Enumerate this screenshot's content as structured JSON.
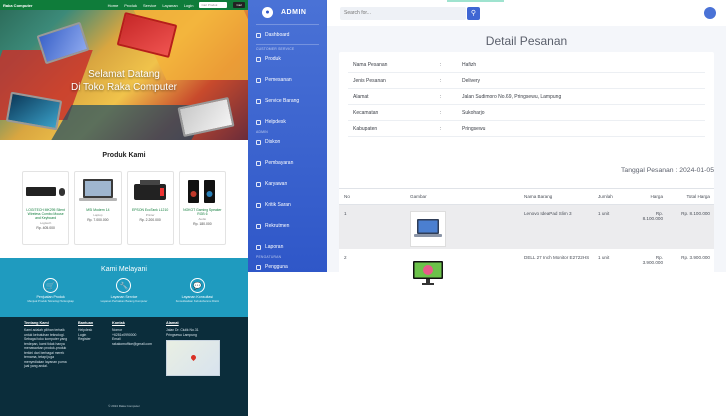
{
  "store": {
    "nav": {
      "brand": "Raka Computer",
      "links": [
        "Home",
        "Produk",
        "Service",
        "Layanan",
        "Login"
      ],
      "search_placeholder": "Cari Produk",
      "search_button": "Cari"
    },
    "hero": {
      "line1": "Selamat Datang",
      "line2": "Di Toko Raka Computer"
    },
    "produk_title": "Produk Kami",
    "products": [
      {
        "name": "LOGITECH MK295 Silent Wireless Combo Mouse and Keyboard",
        "brand": "Logitech",
        "price": "Rp. 405.000"
      },
      {
        "name": "MSI Modern 14",
        "brand": "Laptop",
        "price": "Rp. 7.000.000"
      },
      {
        "name": "EPSON EcoTank L1210",
        "brand": "Printer",
        "price": "Rp. 2.200.000"
      },
      {
        "name": "NOKOT Gaming Speaker RGB 6",
        "brand": "Audio",
        "price": "Rp. 180.000"
      }
    ],
    "layanan": {
      "title": "Kami Melayani",
      "items": [
        {
          "title": "Penjualan Produk",
          "desc": "Menjual Produk Teknologi Terlengkap"
        },
        {
          "title": "Layanan Service",
          "desc": "Layanan Perbaikan Barang Komputer"
        },
        {
          "title": "Layanan Konsultasi",
          "desc": "Konsultasikan Kebutuhanmu Disini"
        }
      ]
    },
    "footer": {
      "about_title": "Tentang Kami",
      "about_text": "Kami adalah pilihan terbaik untuk kebutuhan teknologi. Sebagai toko komputer yang terdepan, kami tidak hanya menawarkan produk-produk terkini dari berbagai merek ternama, tetapi juga menyediakan layanan purna jual yang andal.",
      "bantuan_title": "Bantuan",
      "bantuan_links": [
        "Helpdesk",
        "Login",
        "Register"
      ],
      "kontak_title": "Kontak",
      "kontak_lines": [
        "Nomor",
        "+6281x0990000",
        "",
        "Email",
        "rakakomoffice@gmail.com"
      ],
      "alamat_title": "Alamat",
      "alamat_text": "Jalan Dr. Ciulik No.31 Pringsewu Lampung",
      "copyright": "© 2024 Raka Computer"
    }
  },
  "admin": {
    "brand": "ADMIN",
    "sidebar": {
      "dashboard": "Dashboard",
      "head_customer": "CUSTOMER SERVICE",
      "items_cs": [
        "Produk",
        "Pemesanan",
        "Service Barang",
        "Helpdesk"
      ],
      "head_admin": "ADMIN",
      "items_admin": [
        "Diskon",
        "Pembayaran",
        "Karyawan",
        "Kritik Saran",
        "Rekrutmen",
        "Laporan"
      ],
      "head_pengaturan": "PENGATURAN",
      "items_pengaturan": [
        "Pengguna"
      ]
    },
    "search_placeholder": "Search for...",
    "page_title": "Detail Pesanan",
    "info": [
      {
        "k": "Nama Pesanan",
        "v": "Hafizh"
      },
      {
        "k": "Jenis Pesanan",
        "v": "Delivery"
      },
      {
        "k": "Alamat",
        "v": "Jalan Sudimoro No.69, Pringsewu, Lampung"
      },
      {
        "k": "Kecamatan",
        "v": "Sukoharjo"
      },
      {
        "k": "Kabupaten",
        "v": "Pringsewu"
      }
    ],
    "separator": ":",
    "tanggal": "Tanggal Pesanan : 2024-01-05",
    "table": {
      "headers": [
        "No",
        "Gambar",
        "Nama Barang",
        "Jumlah",
        "Harga",
        "Total Harga"
      ],
      "rows": [
        {
          "no": "1",
          "nama": "Lenovo IdeaPad Slim 3",
          "jumlah": "1 unit",
          "harga": "Rp. 8.100.000",
          "total": "Rp. 8.100.000"
        },
        {
          "no": "2",
          "nama": "DELL 27 Inch Monitor E2722HS",
          "jumlah": "1 unit",
          "harga": "Rp. 3.900.000",
          "total": "Rp. 3.900.000"
        }
      ]
    },
    "colors": {
      "primary": "#4a72d6",
      "accent": "#3f66d3"
    }
  }
}
